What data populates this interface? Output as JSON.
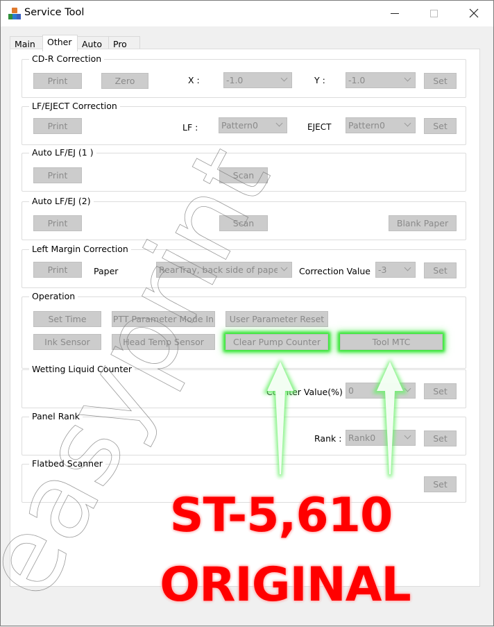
{
  "window": {
    "title": "Service Tool",
    "icon": "service-tool-app-icon",
    "controls": [
      "minimize-icon",
      "maximize-icon",
      "close-icon"
    ]
  },
  "tabs": [
    {
      "label": "Main",
      "active": false
    },
    {
      "label": "Other",
      "active": true
    },
    {
      "label": "Auto",
      "active": false
    },
    {
      "label": "Pro",
      "active": false
    }
  ],
  "groups": {
    "cdr": {
      "title": "CD-R Correction",
      "print": "Print",
      "zero": "Zero",
      "x_label": "X :",
      "x_value": "-1.0",
      "y_label": "Y :",
      "y_value": "-1.0",
      "set": "Set"
    },
    "lfeject": {
      "title": "LF/EJECT Correction",
      "print": "Print",
      "lf_label": "LF :",
      "lf_value": "Pattern0",
      "eject_label": "EJECT",
      "eject_value": "Pattern0",
      "set": "Set"
    },
    "autolf1": {
      "title": "Auto LF/EJ (1 )",
      "print": "Print",
      "scan": "Scan"
    },
    "autolf2": {
      "title": "Auto LF/EJ (2)",
      "print": "Print",
      "scan": "Scan",
      "blank_paper": "Blank Paper"
    },
    "leftmargin": {
      "title": "Left Margin Correction",
      "print": "Print",
      "paper_label": "Paper",
      "paper_value": "RearTray, back side of pape",
      "correction_label": "Correction Value",
      "correction_value": "-3",
      "set": "Set"
    },
    "operation": {
      "title": "Operation",
      "set_time": "Set Time",
      "ptt_param": "PTT Parameter Mode In",
      "user_param_reset": "User Parameter Reset",
      "ink_sensor": "Ink Sensor",
      "head_temp_sensor": "Head Temp Sensor",
      "clear_pump_counter": "Clear Pump Counter",
      "tool_mtc": "Tool MTC"
    },
    "wetting": {
      "title": "Wetting Liquid Counter",
      "counter_label": "Counter Value(%)",
      "counter_value": "0",
      "set": "Set"
    },
    "panelrank": {
      "title": "Panel Rank",
      "rank_label": "Rank :",
      "rank_value": "Rank0",
      "set": "Set"
    },
    "flatbed": {
      "title": "Flatbed Scanner",
      "set": "Set"
    }
  },
  "overlay": {
    "line1": "ST-5,610",
    "line2": "ORIGINAL",
    "text_color": "#ff0000",
    "arrow_color": "#33e033",
    "watermark": "easyprint"
  }
}
